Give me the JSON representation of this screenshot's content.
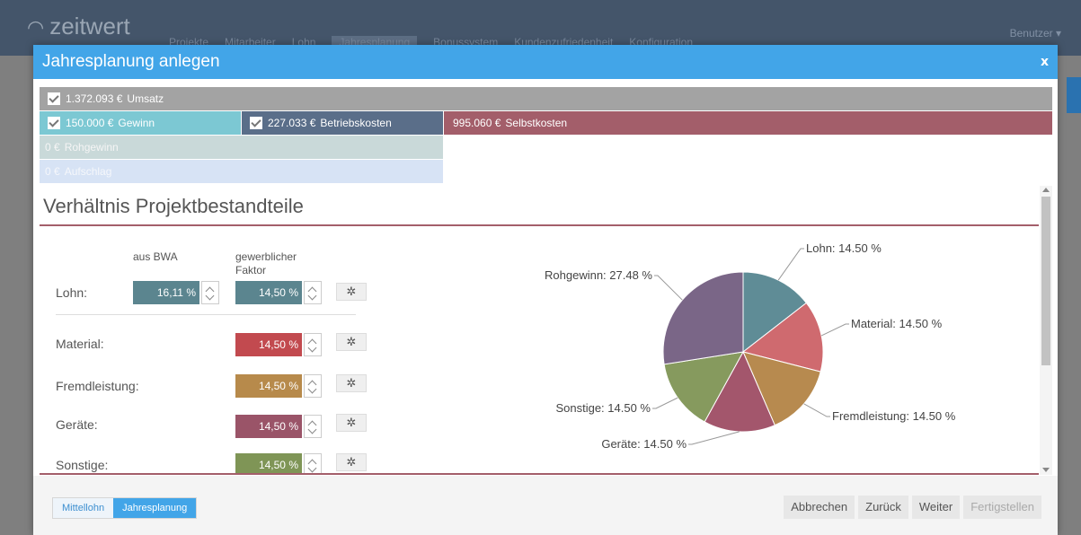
{
  "app": {
    "logo": "zeitwert",
    "nav": [
      "Projekte",
      "Mitarbeiter",
      "Lohn",
      "Jahresplanung",
      "Bonussystem",
      "Kundenzufriedenheit",
      "Konfiguration"
    ],
    "user": "Benutzer ▾"
  },
  "modal": {
    "title": "Jahresplanung anlegen",
    "close": "x"
  },
  "bars": {
    "umsatz": {
      "amount": "1.372.093 €",
      "label": "Umsatz"
    },
    "gewinn": {
      "amount": "150.000 €",
      "label": "Gewinn"
    },
    "betriebskosten": {
      "amount": "227.033 €",
      "label": "Betriebskosten"
    },
    "selbstkosten": {
      "amount": "995.060 €",
      "label": "Selbstkosten"
    },
    "rohgewinn": {
      "amount": "0 €",
      "label": "Rohgewinn"
    },
    "aufschlag": {
      "amount": "0 €",
      "label": "Aufschlag"
    }
  },
  "section": {
    "title": "Verhältnis Projektbestandteile",
    "col_bwa": "aus BWA",
    "col_factor_line1": "gewerblicher",
    "col_factor_line2": "Faktor",
    "rows": [
      {
        "label": "Lohn:",
        "bwa": "16,11 %",
        "value": "14,50 %",
        "color": "#5b858f"
      },
      {
        "label": "Material:",
        "value": "14,50 %",
        "color": "#c24a4f"
      },
      {
        "label": "Fremdleistung:",
        "value": "14,50 %",
        "color": "#b78a4b"
      },
      {
        "label": "Geräte:",
        "value": "14,50 %",
        "color": "#9a5468"
      },
      {
        "label": "Sonstige:",
        "value": "14,50 %",
        "color": "#7f9556"
      }
    ]
  },
  "chart_data": {
    "type": "pie",
    "slices": [
      {
        "label": "Lohn",
        "value": 14.5,
        "display": "Lohn: 14.50 %",
        "color": "#5f8c96"
      },
      {
        "label": "Material",
        "value": 14.5,
        "display": "Material: 14.50 %",
        "color": "#cf6a6f"
      },
      {
        "label": "Fremdleistung",
        "value": 14.5,
        "display": "Fremdleistung: 14.50 %",
        "color": "#b78a4f"
      },
      {
        "label": "Geräte",
        "value": 14.5,
        "display": "Geräte: 14.50 %",
        "color": "#a3566c"
      },
      {
        "label": "Sonstige",
        "value": 14.5,
        "display": "Sonstige: 14.50 %",
        "color": "#869a5e"
      },
      {
        "label": "Rohgewinn",
        "value": 27.48,
        "display": "Rohgewinn: 27.48 %",
        "color": "#7a6687"
      }
    ]
  },
  "footer": {
    "tab_mittellohn": "Mittellohn",
    "tab_jahresplanung": "Jahresplanung",
    "btn_abbrechen": "Abbrechen",
    "btn_zurueck": "Zurück",
    "btn_weiter": "Weiter",
    "btn_fertigstellen": "Fertigstellen"
  }
}
